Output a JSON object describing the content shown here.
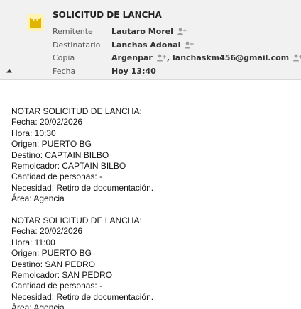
{
  "header": {
    "app_icon": "lighthouse-mail-icon",
    "subject": "SOLICITUD DE LANCHA",
    "fields": {
      "remitente": {
        "label": "Remitente",
        "value": "Lautaro Morel"
      },
      "destinatario": {
        "label": "Destinatario",
        "value": "Lanchas Adonai"
      },
      "copia": {
        "label": "Copia",
        "values": [
          "Argenpar",
          "lanchaskm456@gmail.com"
        ],
        "separator": ","
      },
      "fecha": {
        "label": "Fecha",
        "value": "Hoy 13:40"
      }
    },
    "icons": {
      "contact": "add-contact-icon",
      "collapse": "caret-up-icon"
    },
    "colors": {
      "header_bg": "#f1f1f1",
      "icon_bg": "#fff3b3",
      "icon_fg": "#e0b400"
    }
  },
  "body": {
    "blocks": [
      {
        "title": "NOTAR SOLICITUD DE LANCHA:",
        "fecha": "Fecha: 20/02/2026",
        "hora": "Hora: 10:30",
        "origen": "Origen: PUERTO BG",
        "destino": "Destino: CAPTAIN BILBO",
        "remolcador": "Remolcador: CAPTAIN BILBO",
        "cantidad": "Cantidad de personas: -",
        "necesidad": "Necesidad: Retiro de documentación.",
        "area": "Área: Agencia"
      },
      {
        "title": "NOTAR SOLICITUD DE LANCHA:",
        "fecha": "Fecha: 20/02/2026",
        "hora": "Hora: 11:00",
        "origen": "Origen: PUERTO BG",
        "destino": "Destino: SAN PEDRO",
        "remolcador": "Remolcador: SAN PEDRO",
        "cantidad": "Cantidad de personas: -",
        "necesidad": "Necesidad: Retiro de documentación.",
        "area": "Área: Agencia"
      }
    ]
  }
}
